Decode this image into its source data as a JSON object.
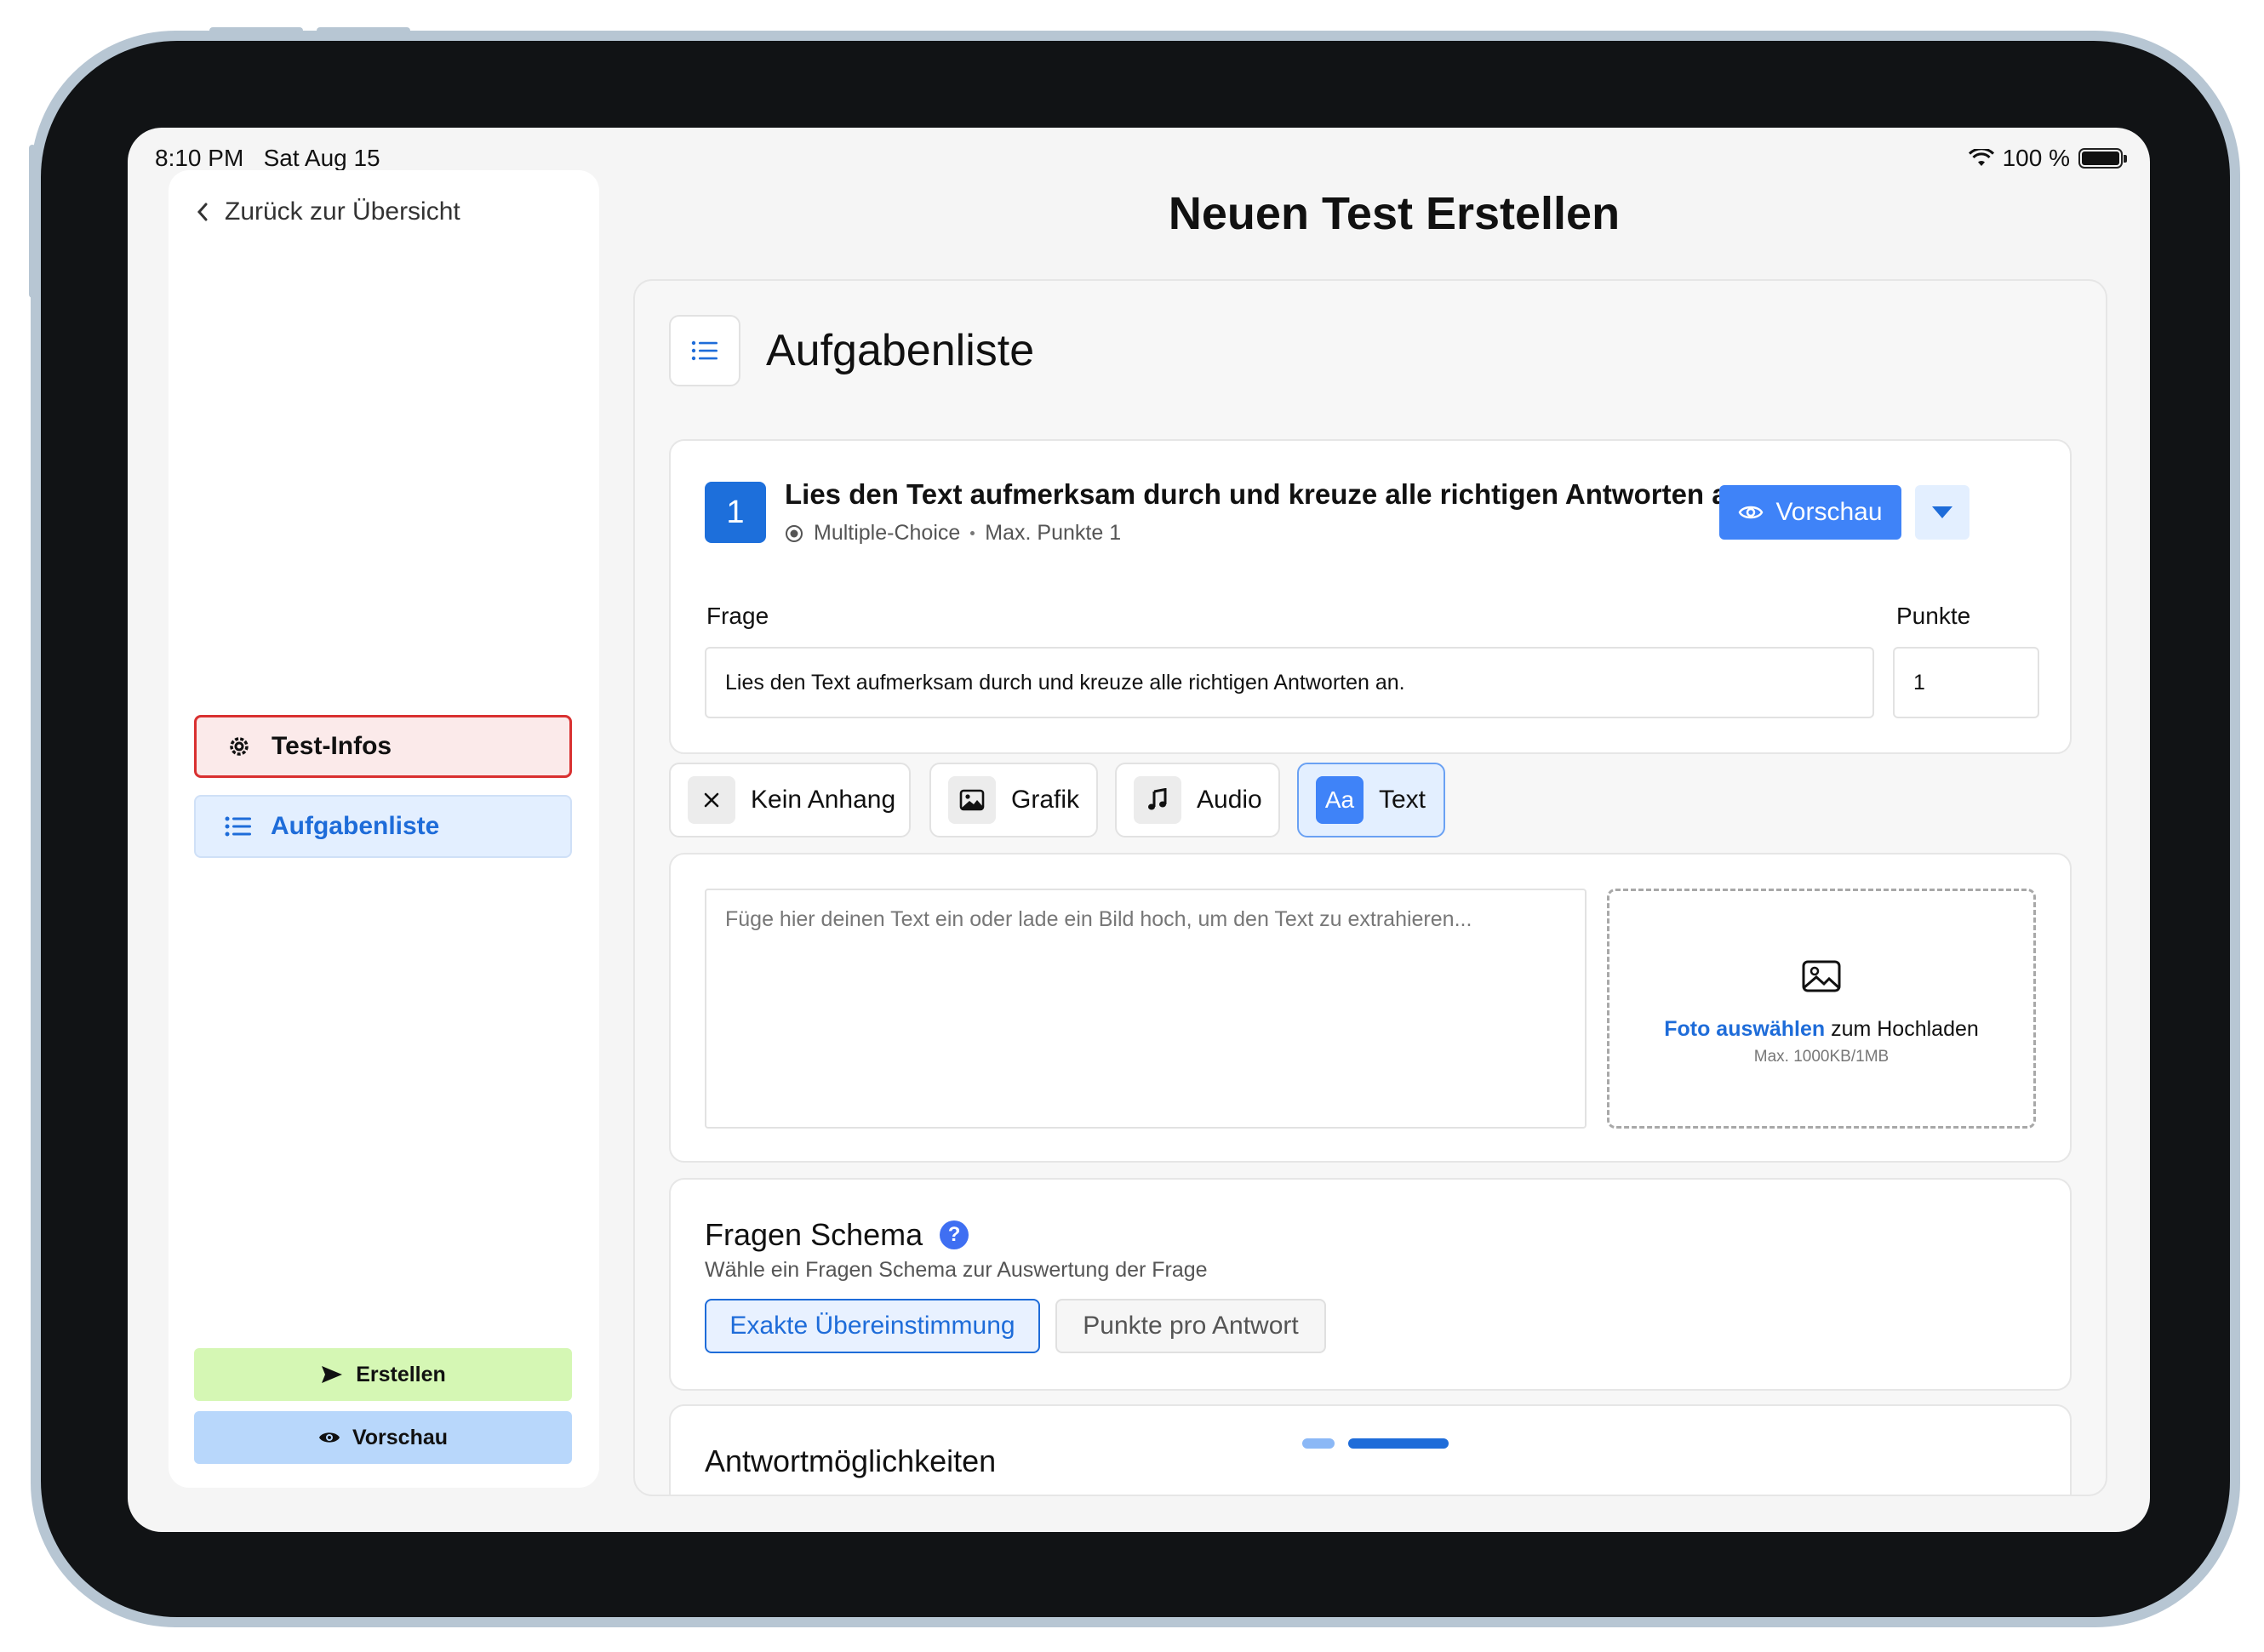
{
  "status_bar": {
    "time": "8:10 PM",
    "date": "Sat Aug 15",
    "battery": "100 %"
  },
  "sidebar": {
    "back_label": "Zurück zur Übersicht",
    "nav": [
      {
        "label": "Test-Infos",
        "icon": "gear-icon",
        "state": "error"
      },
      {
        "label": "Aufgabenliste",
        "icon": "list-icon",
        "state": "active"
      }
    ],
    "actions": {
      "create_label": "Erstellen",
      "preview_label": "Vorschau"
    }
  },
  "page": {
    "title": "Neuen Test Erstellen"
  },
  "main": {
    "section_title": "Aufgabenliste",
    "question": {
      "number": "1",
      "title": "Lies den Text aufmerksam durch und kreuze alle richtigen Antworten an.",
      "type": "Multiple-Choice",
      "max_points": "Max. Punkte 1",
      "preview_label": "Vorschau",
      "question_label": "Frage",
      "question_value": "Lies den Text aufmerksam durch und kreuze alle richtigen Antworten an.",
      "points_label": "Punkte",
      "points_value": "1"
    },
    "attachment_tabs": [
      {
        "label": "Kein Anhang",
        "icon": "close-icon",
        "active": false
      },
      {
        "label": "Grafik",
        "icon": "image-icon",
        "active": false
      },
      {
        "label": "Audio",
        "icon": "music-note-icon",
        "active": false
      },
      {
        "label": "Text",
        "icon_text": "Aa",
        "active": true
      }
    ],
    "text_attachment": {
      "placeholder": "Füge hier deinen Text ein oder lade ein Bild hoch, um den Text zu extrahieren...",
      "upload_link": "Foto auswählen",
      "upload_rest": " zum Hochladen",
      "upload_limit": "Max. 1000KB/1MB"
    },
    "schema": {
      "title": "Fragen Schema",
      "help": "?",
      "subtitle": "Wähle ein Fragen Schema zur Auswertung der Frage",
      "options": [
        {
          "label": "Exakte Übereinstimmung",
          "selected": true
        },
        {
          "label": "Punkte pro Antwort",
          "selected": false
        }
      ]
    },
    "answers": {
      "title": "Antwortmöglichkeiten"
    }
  },
  "colors": {
    "primary": "#3f83f8",
    "accent_text": "#1e6cd9",
    "error": "#d93030",
    "create_bg": "#d5f7b4",
    "preview_bg": "#b8d7fb"
  }
}
